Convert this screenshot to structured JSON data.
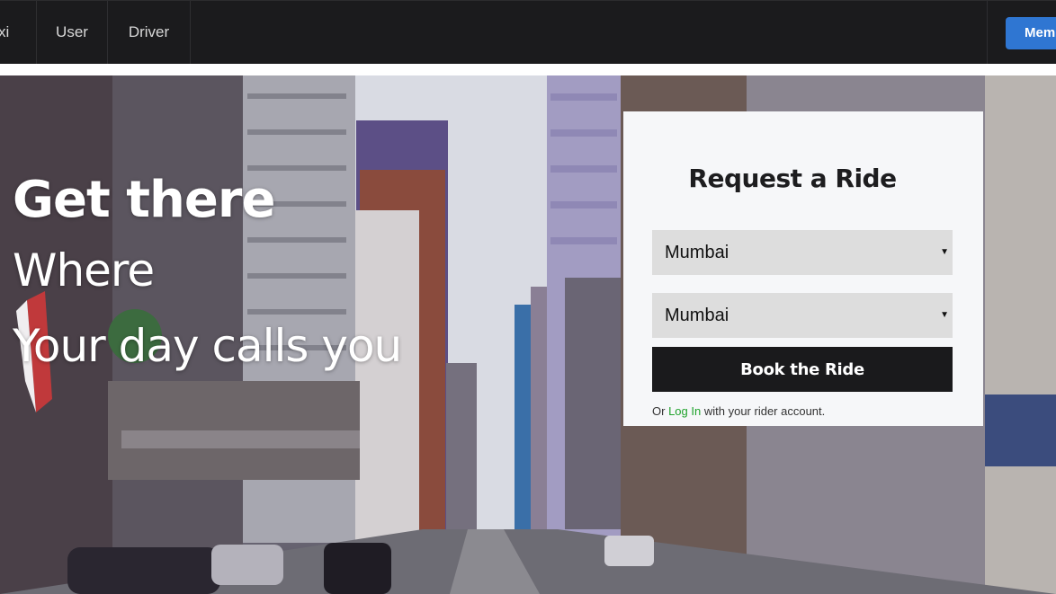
{
  "navbar": {
    "brand": "Taxi",
    "items": [
      {
        "label": "User"
      },
      {
        "label": "Driver"
      }
    ],
    "member_button": "Member"
  },
  "hero": {
    "line1": "Get there",
    "line2": "Where",
    "line3": "Your day calls you"
  },
  "ride_form": {
    "title": "Request a Ride",
    "from_value": "Mumbai",
    "to_value": "Mumbai",
    "submit_label": "Book the Ride",
    "login_prefix": "Or",
    "login_link": "Log In",
    "login_suffix": "with your rider account."
  },
  "colors": {
    "navbar_bg": "#1b1b1d",
    "member_button_bg": "#2f76d2",
    "book_button_bg": "#1a1a1c",
    "login_link": "#21a32d",
    "panel_bg": "#f6f7f9"
  }
}
